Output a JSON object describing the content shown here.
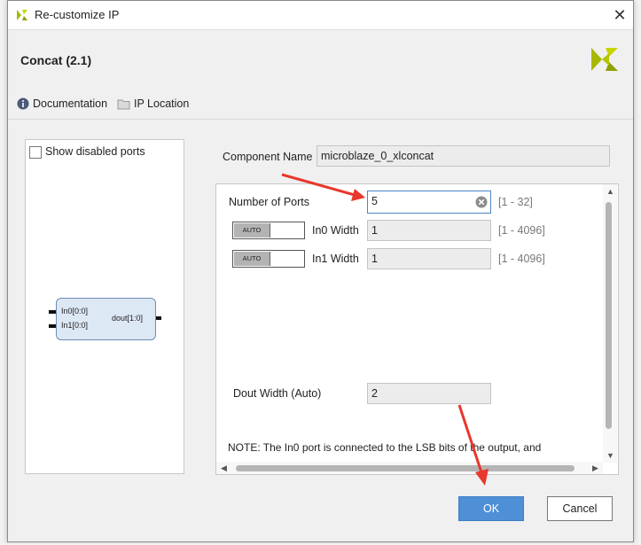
{
  "window": {
    "title": "Re-customize IP"
  },
  "header": {
    "ip_name": "Concat (2.1)"
  },
  "links": {
    "documentation": "Documentation",
    "ip_location": "IP Location"
  },
  "left_panel": {
    "show_disabled_ports": "Show disabled ports",
    "block": {
      "in0": "In0[0:0]",
      "in1": "In1[0:0]",
      "out": "dout[1:0]"
    }
  },
  "component": {
    "label": "Component Name",
    "value": "microblaze_0_xlconcat"
  },
  "params": {
    "num_ports_label": "Number of Ports",
    "num_ports_value": "5",
    "num_ports_range": "[1 - 32]",
    "toggle_label": "AUTO",
    "in0_label": "In0 Width",
    "in0_value": "1",
    "in0_range": "[1 - 4096]",
    "in1_label": "In1 Width",
    "in1_value": "1",
    "in1_range": "[1 - 4096]",
    "dout_label": "Dout Width (Auto)",
    "dout_value": "2",
    "note": "NOTE: The In0 port is connected to the LSB bits of the output, and"
  },
  "buttons": {
    "ok": "OK",
    "cancel": "Cancel"
  },
  "colors": {
    "accent_button": "#4f8fd6",
    "annotation_arrow": "#e8372c",
    "xilinx_logo": "#a8b800"
  }
}
